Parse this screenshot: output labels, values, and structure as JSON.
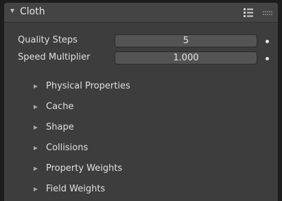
{
  "panel": {
    "title": "Cloth",
    "header_icons": [
      "presets-list-icon",
      "drag-grip-icon"
    ]
  },
  "properties": [
    {
      "label": "Quality Steps",
      "value": "5"
    },
    {
      "label": "Speed Multiplier",
      "value": "1.000"
    }
  ],
  "subpanels": [
    {
      "label": "Physical Properties"
    },
    {
      "label": "Cache"
    },
    {
      "label": "Shape"
    },
    {
      "label": "Collisions"
    },
    {
      "label": "Property Weights"
    },
    {
      "label": "Field Weights"
    }
  ]
}
